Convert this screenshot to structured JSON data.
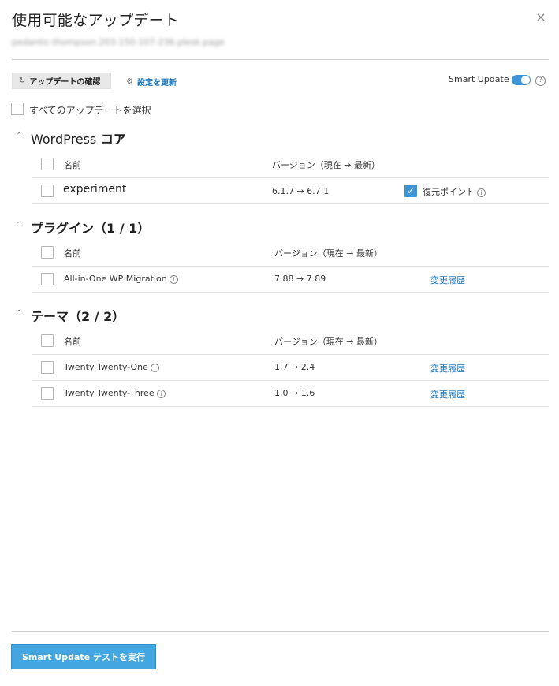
{
  "dialog": {
    "title": "使用可能なアップデート",
    "close_glyph": "×",
    "subtitle": "pedantic-thompson.203-150-107-236.plesk.page"
  },
  "toolbar": {
    "check_updates_label": "アップデートの確認",
    "update_settings_label": "設定を更新",
    "smart_update_label": "Smart Update",
    "smart_update_enabled": true,
    "help_glyph": "?"
  },
  "select_all_label": "すべてのアップデートを選択",
  "sections": {
    "core": {
      "title_latin": "WordPress",
      "title_jp": "コア",
      "col_name": "名前",
      "col_version": "バージョン（現在 → 最新）",
      "rows": [
        {
          "name": "experiment",
          "version": "6.1.7 → 6.7.1",
          "extra": "復元ポイント",
          "extra_checked": true
        }
      ]
    },
    "plugins": {
      "title": "プラグイン（1 / 1）",
      "col_name": "名前",
      "col_version": "バージョン（現在 → 最新）",
      "rows": [
        {
          "name": "All-in-One WP Migration",
          "version": "7.88 → 7.89",
          "link": "変更履歴"
        }
      ]
    },
    "themes": {
      "title": "テーマ（2 / 2）",
      "col_name": "名前",
      "col_version": "バージョン（現在 → 最新）",
      "rows": [
        {
          "name": "Twenty Twenty-One",
          "version": "1.7 → 2.4",
          "link": "変更履歴"
        },
        {
          "name": "Twenty Twenty-Three",
          "version": "1.0 → 1.6",
          "link": "変更履歴"
        }
      ]
    }
  },
  "footer": {
    "run_test_label": "Smart Update テストを実行"
  },
  "colors": {
    "accent": "#44a6e0",
    "link": "#1a73b8"
  },
  "icons": {
    "refresh": "refresh-icon",
    "gear": "gear-icon",
    "info": "info-icon",
    "chevron": "chevron-up-icon",
    "close": "close-icon"
  }
}
